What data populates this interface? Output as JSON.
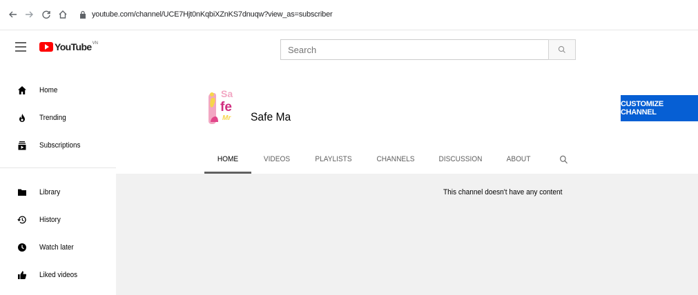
{
  "browser": {
    "url": "youtube.com/channel/UCE7Hjt0nKqbiXZnKS7dnuqw?view_as=subscriber"
  },
  "header": {
    "logo_text": "YouTube",
    "logo_country": "VN",
    "search_placeholder": "Search"
  },
  "sidebar": {
    "items": [
      {
        "label": "Home",
        "icon": "home-icon"
      },
      {
        "label": "Trending",
        "icon": "trending-icon"
      },
      {
        "label": "Subscriptions",
        "icon": "subscriptions-icon"
      },
      {
        "label": "Library",
        "icon": "library-icon"
      },
      {
        "label": "History",
        "icon": "history-icon"
      },
      {
        "label": "Watch later",
        "icon": "watch-later-icon"
      },
      {
        "label": "Liked videos",
        "icon": "liked-videos-icon"
      }
    ]
  },
  "channel": {
    "name": "Safe Ma",
    "customize_label": "CUSTOMIZE CHANNEL",
    "tabs": [
      {
        "label": "HOME",
        "active": true
      },
      {
        "label": "VIDEOS",
        "active": false
      },
      {
        "label": "PLAYLISTS",
        "active": false
      },
      {
        "label": "CHANNELS",
        "active": false
      },
      {
        "label": "DISCUSSION",
        "active": false
      },
      {
        "label": "ABOUT",
        "active": false
      }
    ]
  },
  "content": {
    "empty_message": "This channel doesn't have any content"
  },
  "colors": {
    "youtube_red": "#ff0000",
    "customize_blue": "#065fd4",
    "content_bg": "#f1f1f1"
  }
}
